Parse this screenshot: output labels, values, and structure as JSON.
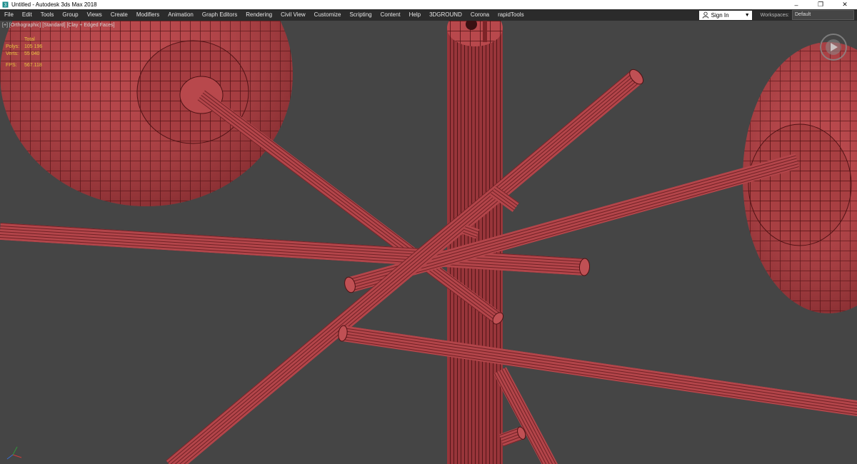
{
  "window": {
    "title": "Untitled - Autodesk 3ds Max 2018",
    "controls": [
      "–",
      "❐",
      "✕"
    ]
  },
  "menu": {
    "items": [
      "File",
      "Edit",
      "Tools",
      "Group",
      "Views",
      "Create",
      "Modifiers",
      "Animation",
      "Graph Editors",
      "Rendering",
      "Civil View",
      "Customize",
      "Scripting",
      "Content",
      "Help",
      "3DGROUND",
      "Corona",
      "rapidTools"
    ],
    "sign_in": "Sign In",
    "workspaces_label": "Workspaces:",
    "workspace_value": "Default"
  },
  "viewport": {
    "label": "[+] [Orthographic] [Standard] [Clay + Edged Faces]",
    "stats": {
      "header": "Total",
      "polys_label": "Polys:",
      "polys": "105 196",
      "verts_label": "Verts:",
      "verts": "55 040",
      "fps_label": "FPS:",
      "fps": "567.118"
    }
  },
  "colors": {
    "clay": "#b8484c",
    "clay_dark": "#7c2226",
    "wire": "#4a1012",
    "viewport_bg": "#454545",
    "stats_text": "#e8c640"
  }
}
